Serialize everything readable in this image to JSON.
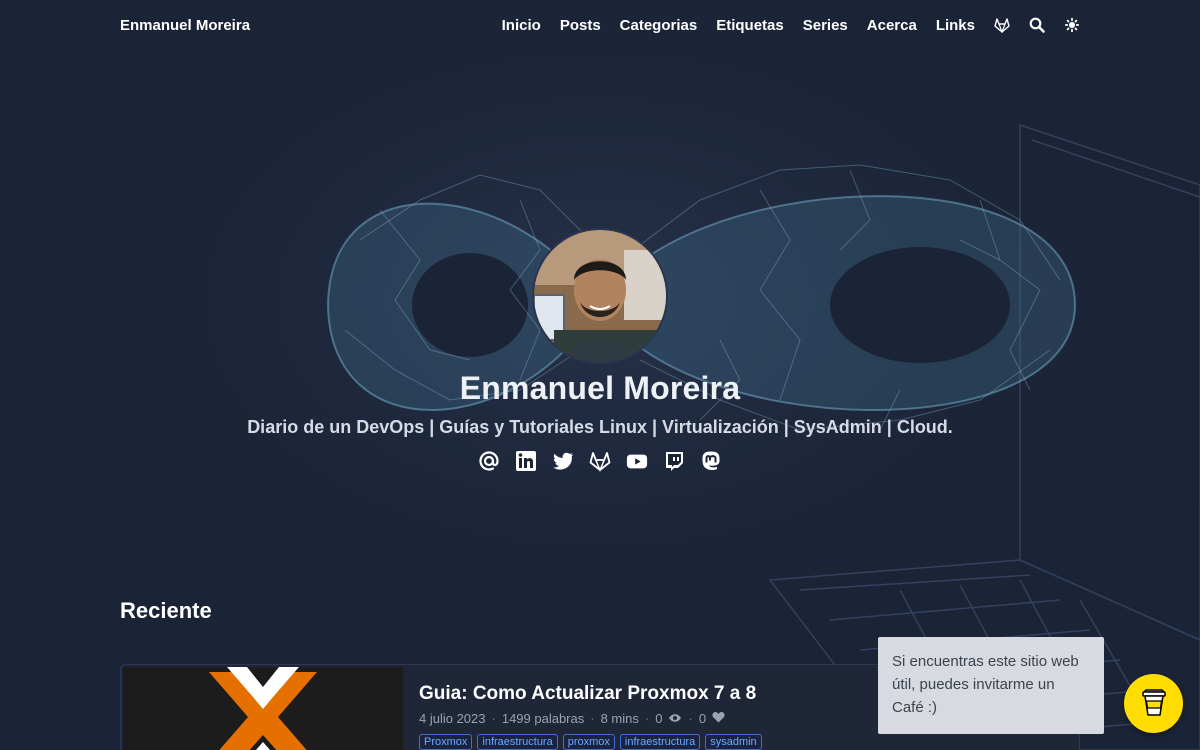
{
  "nav": {
    "brand": "Enmanuel Moreira",
    "links": [
      "Inicio",
      "Posts",
      "Categorias",
      "Etiquetas",
      "Series",
      "Acerca",
      "Links"
    ],
    "icons": [
      "gitlab-icon",
      "search-icon",
      "theme-toggle-icon"
    ]
  },
  "hero": {
    "name": "Enmanuel Moreira",
    "subtitle": "Diario de un DevOps | Guías y Tutoriales Linux | Virtualización | SysAdmin | Cloud.",
    "social_icons": [
      "email-icon",
      "linkedin-icon",
      "twitter-icon",
      "gitlab-icon",
      "youtube-icon",
      "twitch-icon",
      "mastodon-icon"
    ]
  },
  "recent": {
    "title": "Reciente",
    "post": {
      "title": "Guia: Como Actualizar Proxmox 7 a 8",
      "date": "4 julio 2023",
      "words": "1499 palabras",
      "read_time": "8 mins",
      "views": "0",
      "likes": "0",
      "tags": [
        "Proxmox",
        "infraestructura",
        "proxmox",
        "infraestructura",
        "sysadmin"
      ]
    }
  },
  "tooltip": {
    "text": "Si encuentras este sitio web útil, puedes invitarme un Café :)"
  },
  "colors": {
    "background": "#1b2336",
    "accent_yellow": "#ffdd00",
    "tag_blue": "#6ea8ff"
  }
}
